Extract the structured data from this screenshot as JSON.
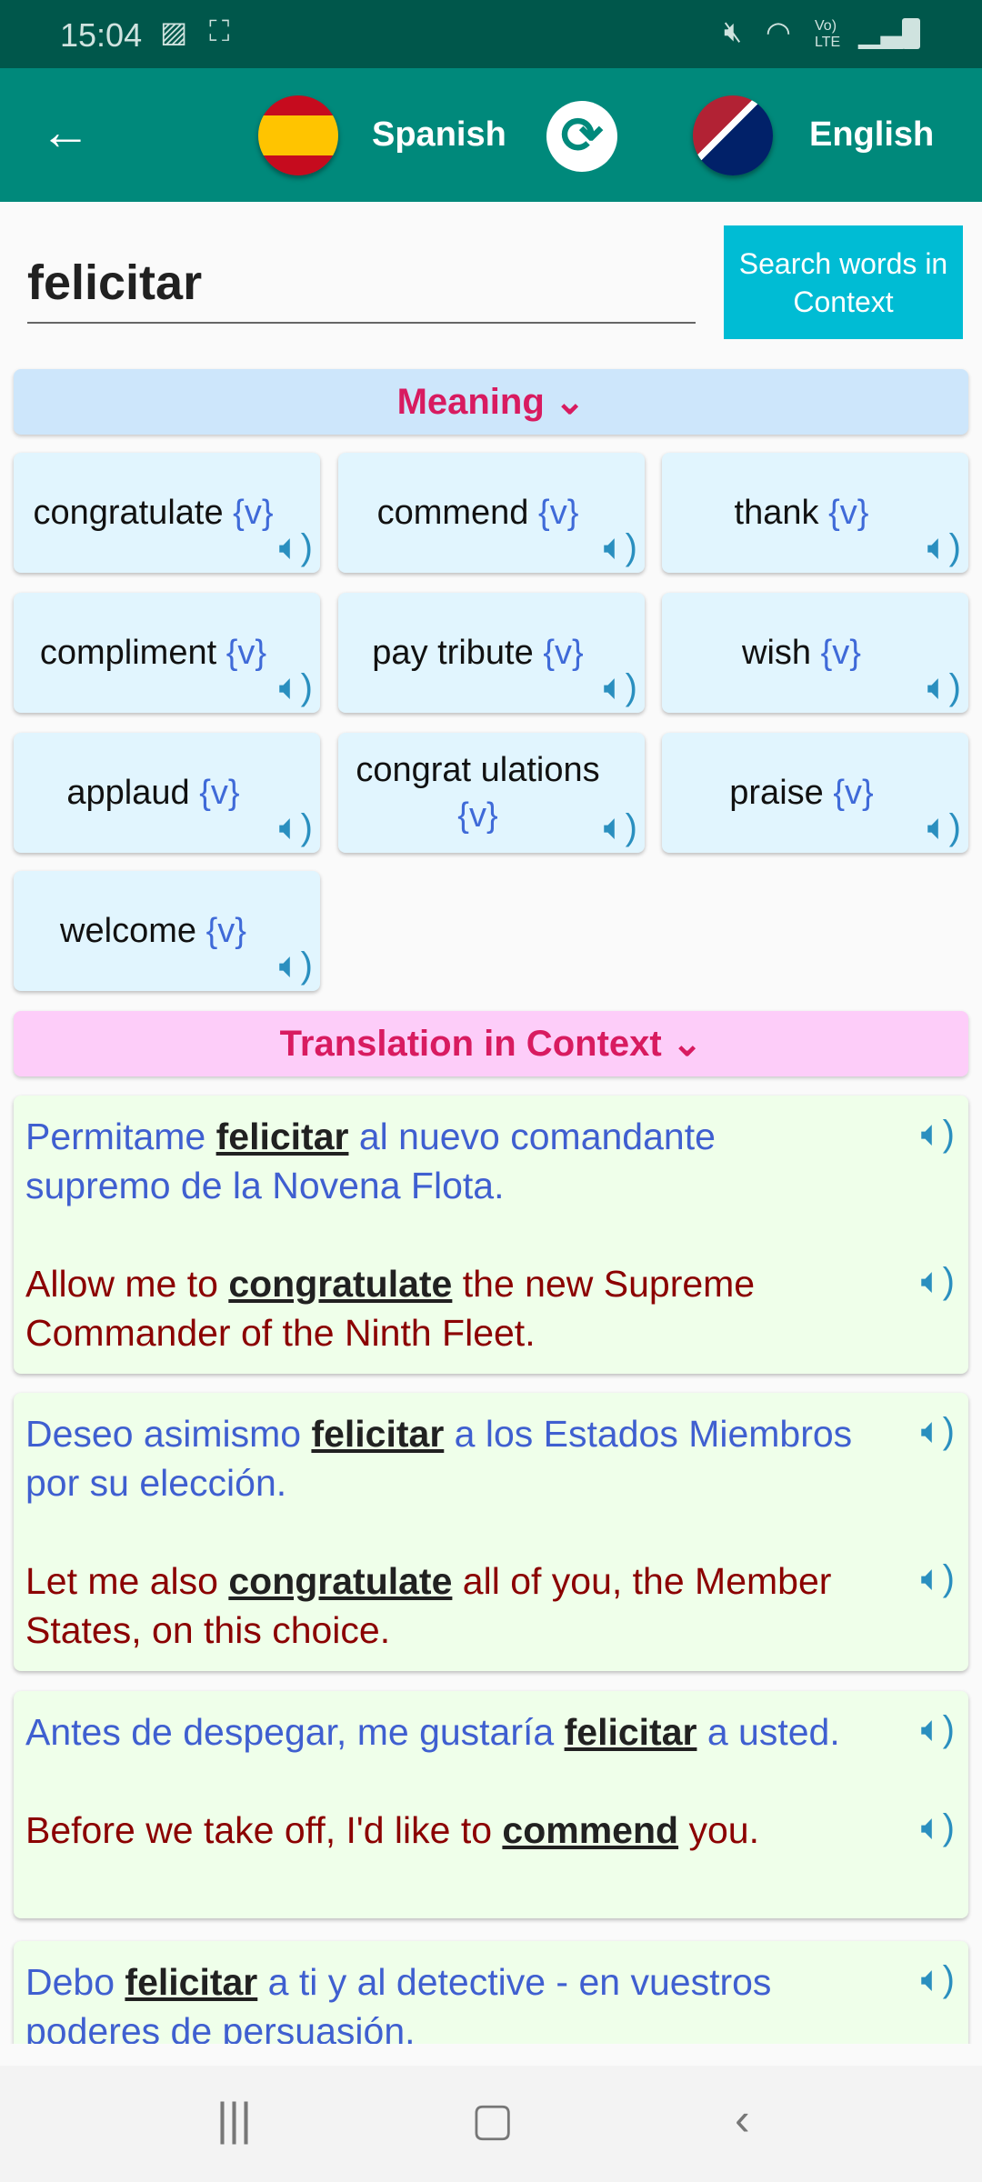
{
  "status_bar": {
    "time": "15:04",
    "icons": [
      "image-icon",
      "screen-record-icon",
      "mute-icon",
      "wifi-icon",
      "volte-icon",
      "signal-icon",
      "battery-icon"
    ],
    "volte": "Vo) LTE"
  },
  "app_bar": {
    "source_lang": "Spanish",
    "target_lang": "English",
    "icons": [
      "back-arrow-icon",
      "spain-flag-icon",
      "swap-icon",
      "us-uk-flag-icon"
    ]
  },
  "search": {
    "value": "felicitar",
    "button": "Search words in Context"
  },
  "meaning": {
    "header": "Meaning",
    "items": [
      {
        "word": "congratulate",
        "pos": "{v}"
      },
      {
        "word": "commend",
        "pos": "{v}"
      },
      {
        "word": "thank",
        "pos": "{v}"
      },
      {
        "word": "compliment",
        "pos": "{v}"
      },
      {
        "word": "pay tribute",
        "pos": "{v}"
      },
      {
        "word": "wish",
        "pos": "{v}"
      },
      {
        "word": "applaud",
        "pos": "{v}"
      },
      {
        "word": "congrat ulations",
        "pos": "{v}"
      },
      {
        "word": "praise",
        "pos": "{v}"
      },
      {
        "word": "welcome",
        "pos": "{v}"
      }
    ]
  },
  "context": {
    "header": "Translation in Context",
    "items": [
      {
        "es": [
          "Permitame ",
          "felicitar",
          " al nuevo comandante supremo de la Novena Flota."
        ],
        "en": [
          "Allow me to ",
          "congratulate",
          " the new Supreme Commander of the Ninth Fleet."
        ]
      },
      {
        "es": [
          "Deseo asimismo ",
          "felicitar",
          " a los Estados Miembros por su elección."
        ],
        "en": [
          "Let me also ",
          "congratulate",
          " all of you, the Member States, on this choice."
        ]
      },
      {
        "es": [
          "Antes de despegar, me gustaría ",
          "felicitar",
          " a usted."
        ],
        "en": [
          "Before we take off, I'd like to ",
          "commend",
          " you."
        ]
      },
      {
        "es": [
          "Debo ",
          "felicitar",
          " a ti y al detective - en vuestros poderes de persuasión."
        ],
        "en": [
          "",
          "",
          ""
        ]
      }
    ]
  },
  "colors": {
    "status_bar": "#00574b",
    "app_bar": "#00897b",
    "button": "#00bcd4",
    "section_text": "#d81b60",
    "spanish_text": "#3f5fd0",
    "english_text": "#8b0000"
  }
}
